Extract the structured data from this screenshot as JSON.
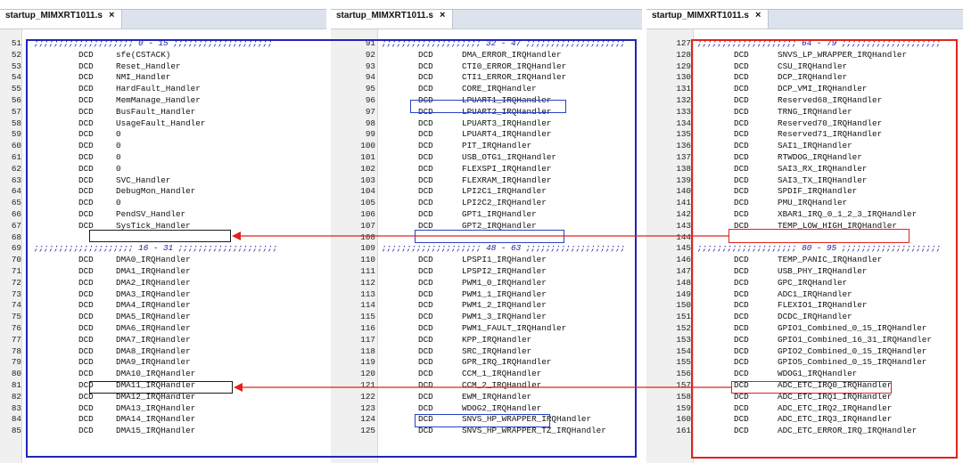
{
  "panes": [
    {
      "tab": {
        "title": "startup_MIMXRT1011.s",
        "close": "×"
      },
      "lines": [
        {
          "n": "51",
          "kind": "comment",
          "text": ";;;;;;;;;;;;;;;;;;;; 0 - 15 ;;;;;;;;;;;;;;;;;;;;"
        },
        {
          "n": "52",
          "kw": "DCD",
          "arg": "sfe(CSTACK)"
        },
        {
          "n": "53",
          "kw": "DCD",
          "arg": "Reset_Handler"
        },
        {
          "n": "54",
          "kw": "DCD",
          "arg": "NMI_Handler"
        },
        {
          "n": "55",
          "kw": "DCD",
          "arg": "HardFault_Handler"
        },
        {
          "n": "56",
          "kw": "DCD",
          "arg": "MemManage_Handler"
        },
        {
          "n": "57",
          "kw": "DCD",
          "arg": "BusFault_Handler"
        },
        {
          "n": "58",
          "kw": "DCD",
          "arg": "UsageFault_Handler"
        },
        {
          "n": "59",
          "kw": "DCD",
          "arg": "0"
        },
        {
          "n": "60",
          "kw": "DCD",
          "arg": "0"
        },
        {
          "n": "61",
          "kw": "DCD",
          "arg": "0"
        },
        {
          "n": "62",
          "kw": "DCD",
          "arg": "0"
        },
        {
          "n": "63",
          "kw": "DCD",
          "arg": "SVC_Handler"
        },
        {
          "n": "64",
          "kw": "DCD",
          "arg": "DebugMon_Handler"
        },
        {
          "n": "65",
          "kw": "DCD",
          "arg": "0"
        },
        {
          "n": "66",
          "kw": "DCD",
          "arg": "PendSV_Handler"
        },
        {
          "n": "67",
          "kw": "DCD",
          "arg": "SysTick_Handler"
        },
        {
          "n": "68",
          "kw": "",
          "arg": ""
        },
        {
          "n": "69",
          "kind": "comment",
          "text": ";;;;;;;;;;;;;;;;;;;; 16 - 31 ;;;;;;;;;;;;;;;;;;;;"
        },
        {
          "n": "70",
          "kw": "DCD",
          "arg": "DMA0_IRQHandler"
        },
        {
          "n": "71",
          "kw": "DCD",
          "arg": "DMA1_IRQHandler"
        },
        {
          "n": "72",
          "kw": "DCD",
          "arg": "DMA2_IRQHandler"
        },
        {
          "n": "73",
          "kw": "DCD",
          "arg": "DMA3_IRQHandler"
        },
        {
          "n": "74",
          "kw": "DCD",
          "arg": "DMA4_IRQHandler"
        },
        {
          "n": "75",
          "kw": "DCD",
          "arg": "DMA5_IRQHandler"
        },
        {
          "n": "76",
          "kw": "DCD",
          "arg": "DMA6_IRQHandler"
        },
        {
          "n": "77",
          "kw": "DCD",
          "arg": "DMA7_IRQHandler"
        },
        {
          "n": "78",
          "kw": "DCD",
          "arg": "DMA8_IRQHandler"
        },
        {
          "n": "79",
          "kw": "DCD",
          "arg": "DMA9_IRQHandler"
        },
        {
          "n": "80",
          "kw": "DCD",
          "arg": "DMA10_IRQHandler"
        },
        {
          "n": "81",
          "kw": "DCD",
          "arg": "DMA11_IRQHandler"
        },
        {
          "n": "82",
          "kw": "DCD",
          "arg": "DMA12_IRQHandler"
        },
        {
          "n": "83",
          "kw": "DCD",
          "arg": "DMA13_IRQHandler"
        },
        {
          "n": "84",
          "kw": "DCD",
          "arg": "DMA14_IRQHandler"
        },
        {
          "n": "85",
          "kw": "DCD",
          "arg": "DMA15_IRQHandler"
        }
      ]
    },
    {
      "tab": {
        "title": "startup_MIMXRT1011.s",
        "close": "×"
      },
      "lines": [
        {
          "n": "91",
          "kind": "comment",
          "text": ";;;;;;;;;;;;;;;;;;;; 32 - 47 ;;;;;;;;;;;;;;;;;;;;"
        },
        {
          "n": "92",
          "kw": "DCD",
          "arg": "DMA_ERROR_IRQHandler"
        },
        {
          "n": "93",
          "kw": "DCD",
          "arg": "CTI0_ERROR_IRQHandler"
        },
        {
          "n": "94",
          "kw": "DCD",
          "arg": "CTI1_ERROR_IRQHandler"
        },
        {
          "n": "95",
          "kw": "DCD",
          "arg": "CORE_IRQHandler"
        },
        {
          "n": "96",
          "kw": "DCD",
          "arg": "LPUART1_IRQHandler"
        },
        {
          "n": "97",
          "kw": "DCD",
          "arg": "LPUART2_IRQHandler"
        },
        {
          "n": "98",
          "kw": "DCD",
          "arg": "LPUART3_IRQHandler"
        },
        {
          "n": "99",
          "kw": "DCD",
          "arg": "LPUART4_IRQHandler"
        },
        {
          "n": "100",
          "kw": "DCD",
          "arg": "PIT_IRQHandler"
        },
        {
          "n": "101",
          "kw": "DCD",
          "arg": "USB_OTG1_IRQHandler"
        },
        {
          "n": "102",
          "kw": "DCD",
          "arg": "FLEXSPI_IRQHandler"
        },
        {
          "n": "103",
          "kw": "DCD",
          "arg": "FLEXRAM_IRQHandler"
        },
        {
          "n": "104",
          "kw": "DCD",
          "arg": "LPI2C1_IRQHandler"
        },
        {
          "n": "105",
          "kw": "DCD",
          "arg": "LPI2C2_IRQHandler"
        },
        {
          "n": "106",
          "kw": "DCD",
          "arg": "GPT1_IRQHandler"
        },
        {
          "n": "107",
          "kw": "DCD",
          "arg": "GPT2_IRQHandler"
        },
        {
          "n": "108",
          "kw": "",
          "arg": ""
        },
        {
          "n": "109",
          "kind": "comment",
          "text": ";;;;;;;;;;;;;;;;;;;; 48 - 63 ;;;;;;;;;;;;;;;;;;;;"
        },
        {
          "n": "110",
          "kw": "DCD",
          "arg": "LPSPI1_IRQHandler"
        },
        {
          "n": "111",
          "kw": "DCD",
          "arg": "LPSPI2_IRQHandler"
        },
        {
          "n": "112",
          "kw": "DCD",
          "arg": "PWM1_0_IRQHandler"
        },
        {
          "n": "113",
          "kw": "DCD",
          "arg": "PWM1_1_IRQHandler"
        },
        {
          "n": "114",
          "kw": "DCD",
          "arg": "PWM1_2_IRQHandler"
        },
        {
          "n": "115",
          "kw": "DCD",
          "arg": "PWM1_3_IRQHandler"
        },
        {
          "n": "116",
          "kw": "DCD",
          "arg": "PWM1_FAULT_IRQHandler"
        },
        {
          "n": "117",
          "kw": "DCD",
          "arg": "KPP_IRQHandler"
        },
        {
          "n": "118",
          "kw": "DCD",
          "arg": "SRC_IRQHandler"
        },
        {
          "n": "119",
          "kw": "DCD",
          "arg": "GPR_IRQ_IRQHandler"
        },
        {
          "n": "120",
          "kw": "DCD",
          "arg": "CCM_1_IRQHandler"
        },
        {
          "n": "121",
          "kw": "DCD",
          "arg": "CCM_2_IRQHandler"
        },
        {
          "n": "122",
          "kw": "DCD",
          "arg": "EWM_IRQHandler"
        },
        {
          "n": "123",
          "kw": "DCD",
          "arg": "WDOG2_IRQHandler"
        },
        {
          "n": "124",
          "kw": "DCD",
          "arg": "SNVS_HP_WRAPPER_IRQHandler"
        },
        {
          "n": "125",
          "kw": "DCD",
          "arg": "SNVS_HP_WRAPPER_TZ_IRQHandler"
        }
      ]
    },
    {
      "tab": {
        "title": "startup_MIMXRT1011.s",
        "close": "×"
      },
      "lines": [
        {
          "n": "127",
          "kind": "comment",
          "text": ";;;;;;;;;;;;;;;;;;;; 64 - 79 ;;;;;;;;;;;;;;;;;;;;"
        },
        {
          "n": "128",
          "kw": "DCD",
          "arg": "SNVS_LP_WRAPPER_IRQHandler"
        },
        {
          "n": "129",
          "kw": "DCD",
          "arg": "CSU_IRQHandler"
        },
        {
          "n": "130",
          "kw": "DCD",
          "arg": "DCP_IRQHandler"
        },
        {
          "n": "131",
          "kw": "DCD",
          "arg": "DCP_VMI_IRQHandler"
        },
        {
          "n": "132",
          "kw": "DCD",
          "arg": "Reserved68_IRQHandler"
        },
        {
          "n": "133",
          "kw": "DCD",
          "arg": "TRNG_IRQHandler"
        },
        {
          "n": "134",
          "kw": "DCD",
          "arg": "Reserved70_IRQHandler"
        },
        {
          "n": "135",
          "kw": "DCD",
          "arg": "Reserved71_IRQHandler"
        },
        {
          "n": "136",
          "kw": "DCD",
          "arg": "SAI1_IRQHandler"
        },
        {
          "n": "137",
          "kw": "DCD",
          "arg": "RTWDOG_IRQHandler"
        },
        {
          "n": "138",
          "kw": "DCD",
          "arg": "SAI3_RX_IRQHandler"
        },
        {
          "n": "139",
          "kw": "DCD",
          "arg": "SAI3_TX_IRQHandler"
        },
        {
          "n": "140",
          "kw": "DCD",
          "arg": "SPDIF_IRQHandler"
        },
        {
          "n": "141",
          "kw": "DCD",
          "arg": "PMU_IRQHandler"
        },
        {
          "n": "142",
          "kw": "DCD",
          "arg": "XBAR1_IRQ_0_1_2_3_IRQHandler"
        },
        {
          "n": "143",
          "kw": "DCD",
          "arg": "TEMP_LOW_HIGH_IRQHandler"
        },
        {
          "n": "144",
          "kw": "",
          "arg": ""
        },
        {
          "n": "145",
          "kind": "comment",
          "text": ";;;;;;;;;;;;;;;;;;;; 80 - 95 ;;;;;;;;;;;;;;;;;;;;"
        },
        {
          "n": "146",
          "kw": "DCD",
          "arg": "TEMP_PANIC_IRQHandler"
        },
        {
          "n": "147",
          "kw": "DCD",
          "arg": "USB_PHY_IRQHandler"
        },
        {
          "n": "148",
          "kw": "DCD",
          "arg": "GPC_IRQHandler"
        },
        {
          "n": "149",
          "kw": "DCD",
          "arg": "ADC1_IRQHandler"
        },
        {
          "n": "150",
          "kw": "DCD",
          "arg": "FLEXIO1_IRQHandler"
        },
        {
          "n": "151",
          "kw": "DCD",
          "arg": "DCDC_IRQHandler"
        },
        {
          "n": "152",
          "kw": "DCD",
          "arg": "GPIO1_Combined_0_15_IRQHandler"
        },
        {
          "n": "153",
          "kw": "DCD",
          "arg": "GPIO1_Combined_16_31_IRQHandler"
        },
        {
          "n": "154",
          "kw": "DCD",
          "arg": "GPIO2_Combined_0_15_IRQHandler"
        },
        {
          "n": "155",
          "kw": "DCD",
          "arg": "GPIO5_Combined_0_15_IRQHandler"
        },
        {
          "n": "156",
          "kw": "DCD",
          "arg": "WDOG1_IRQHandler"
        },
        {
          "n": "157",
          "kw": "DCD",
          "arg": "ADC_ETC_IRQ0_IRQHandler"
        },
        {
          "n": "158",
          "kw": "DCD",
          "arg": "ADC_ETC_IRQ1_IRQHandler"
        },
        {
          "n": "159",
          "kw": "DCD",
          "arg": "ADC_ETC_IRQ2_IRQHandler"
        },
        {
          "n": "160",
          "kw": "DCD",
          "arg": "ADC_ETC_IRQ3_IRQHandler"
        },
        {
          "n": "161",
          "kw": "DCD",
          "arg": "ADC_ETC_ERROR_IRQ_IRQHandler"
        }
      ]
    }
  ],
  "colors": {
    "blue_frame": "#1d27b8",
    "red_frame": "#e0241b",
    "line_box": "#1a1a1a",
    "arrow": "#e0241b",
    "comment": "#1a1aa0"
  }
}
